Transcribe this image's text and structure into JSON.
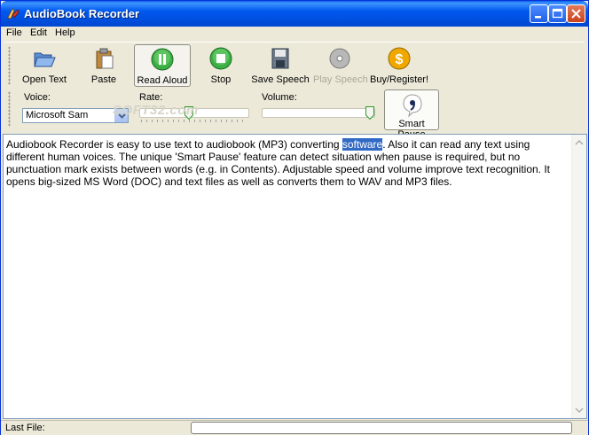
{
  "window": {
    "title": "AudioBook Recorder"
  },
  "menu": {
    "items": [
      "File",
      "Edit",
      "Help"
    ]
  },
  "toolbar": {
    "open_label": "Open Text",
    "paste_label": "Paste",
    "read_aloud_label": "Read Aloud",
    "stop_label": "Stop",
    "save_speech_label": "Save Speech",
    "play_speech_label": "Play Speech",
    "buy_label": "Buy/Register!"
  },
  "settings": {
    "voice_label": "Voice:",
    "voice_value": "Microsoft Sam",
    "rate_label": "Rate:",
    "volume_label": "Volume:",
    "smart_pause_label": "Smart Pause",
    "rate_level": 0.45,
    "volume_level": 0.98
  },
  "watermark": "SOFT32.com",
  "editor": {
    "text_before": "Audiobook Recorder is easy to use text to audiobook (MP3) converting ",
    "selected": "software",
    "text_after": ". Also it can read any text using different human voices. The unique 'Smart Pause' feature can detect situation when pause is required, but no punctuation mark exists between words (e.g. in Contents). Adjustable speed and volume improve text recognition. It opens big-sized MS Word (DOC) and text files as well as converts them to WAV and MP3 files."
  },
  "status": {
    "last_file_label": "Last File:",
    "last_file_value": ""
  },
  "colors": {
    "titlebar": "#0058ee",
    "selection": "#316ac5",
    "play_green": "#3cb043",
    "buy_orange": "#f0a800"
  }
}
